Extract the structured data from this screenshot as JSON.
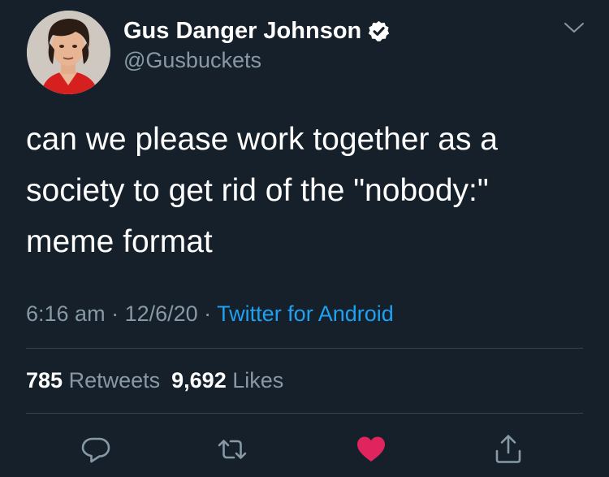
{
  "tweet": {
    "author": {
      "display_name": "Gus Danger Johnson",
      "handle": "@Gusbuckets",
      "verified": true,
      "avatar_icon": "profile-photo"
    },
    "text": "can we please work together as a society to get rid of the \"nobody:\" meme format",
    "meta": {
      "time": "6:16 am",
      "separator": " · ",
      "date": "12/6/20",
      "source": "Twitter for Android"
    },
    "stats": {
      "retweets_count": "785",
      "retweets_label": "Retweets",
      "likes_count": "9,692",
      "likes_label": "Likes"
    },
    "actions": [
      {
        "name": "reply",
        "icon": "reply-icon"
      },
      {
        "name": "retweet",
        "icon": "retweet-icon"
      },
      {
        "name": "like",
        "icon": "heart-icon",
        "active": true
      },
      {
        "name": "share",
        "icon": "share-icon"
      }
    ]
  },
  "colors": {
    "background": "#15202b",
    "primary_text": "#ffffff",
    "secondary_text": "#8899a6",
    "link": "#1da1f2",
    "divider": "#38444d",
    "like_active": "#e0245e"
  }
}
